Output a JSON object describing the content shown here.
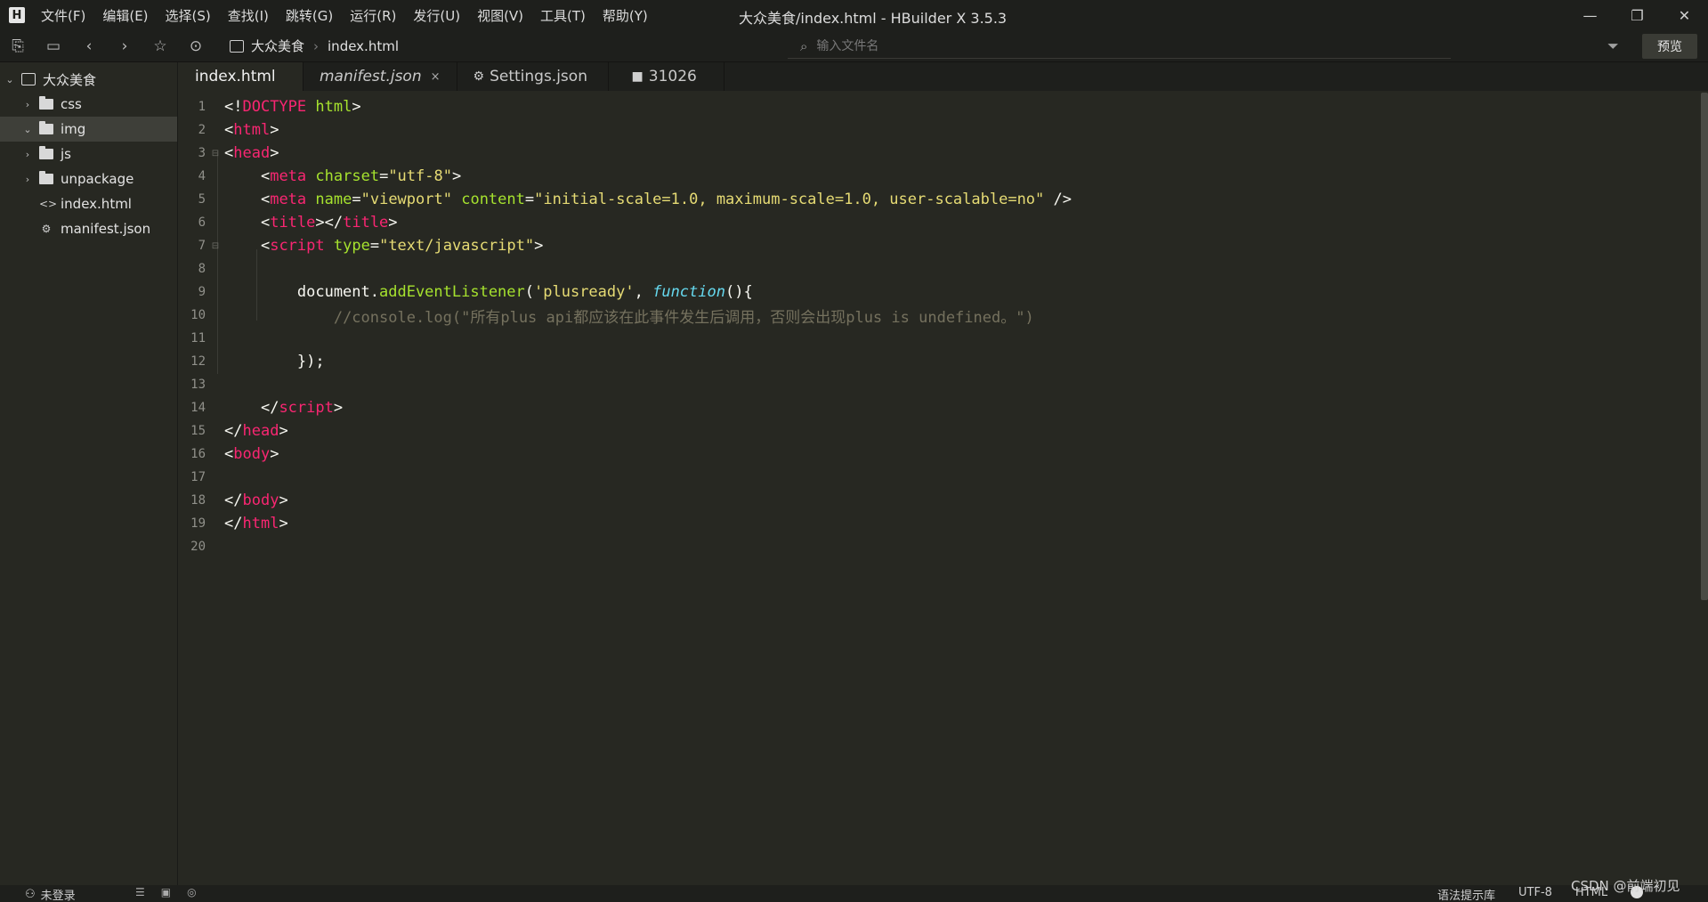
{
  "window": {
    "title": "大众美食/index.html - HBuilder X 3.5.3",
    "logo": "H"
  },
  "menu": [
    "文件(F)",
    "编辑(E)",
    "选择(S)",
    "查找(I)",
    "跳转(G)",
    "运行(R)",
    "发行(U)",
    "视图(V)",
    "工具(T)",
    "帮助(Y)"
  ],
  "toolbar": {
    "breadcrumb": [
      "大众美食",
      "index.html"
    ],
    "search_placeholder": "输入文件名",
    "preview_label": "预览"
  },
  "sidebar": {
    "project": "大众美食",
    "items": [
      {
        "label": "css",
        "type": "folder"
      },
      {
        "label": "img",
        "type": "folder"
      },
      {
        "label": "js",
        "type": "folder"
      },
      {
        "label": "unpackage",
        "type": "folder"
      },
      {
        "label": "index.html",
        "type": "file"
      },
      {
        "label": "manifest.json",
        "type": "file"
      }
    ]
  },
  "tabs": [
    {
      "label": "index.html"
    },
    {
      "label": "manifest.json",
      "close": "×"
    },
    {
      "label": "Settings.json",
      "icon": "⚙"
    },
    {
      "label": "31026",
      "icon": "■"
    }
  ],
  "editor": {
    "line_numbers": [
      "1",
      "2",
      "3",
      "4",
      "5",
      "6",
      "7",
      "8",
      "9",
      "10",
      "11",
      "12",
      "13",
      "14",
      "15",
      "16",
      "17",
      "18",
      "19",
      "20"
    ]
  },
  "statusbar": {
    "login": "未登录",
    "syntax_hint": "语法提示库",
    "encoding": "UTF-8",
    "language": "HTML"
  },
  "watermark": "CSDN @前端初见",
  "colors": {
    "background": "#272822",
    "chrome": "#1e1f1c",
    "tag": "#f92672",
    "attr": "#a6e22e",
    "string": "#e6db74",
    "keyword": "#66d9ef",
    "comment": "#75715e"
  }
}
